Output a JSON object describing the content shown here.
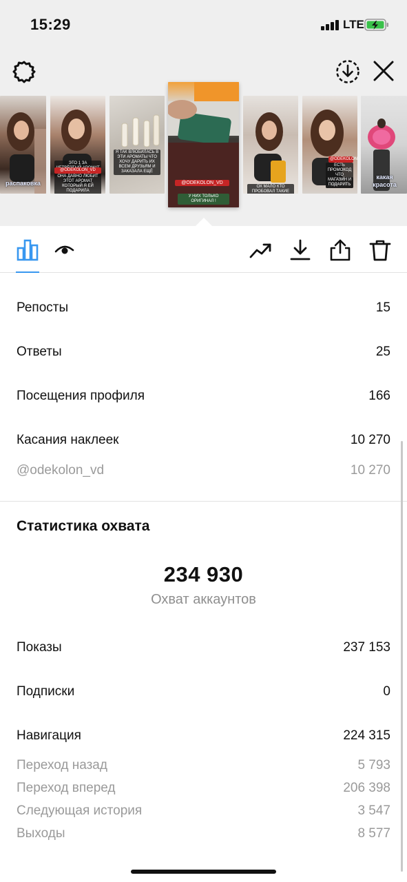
{
  "status_bar": {
    "time": "15:29",
    "network": "LTE"
  },
  "header": {
    "left_icon": "gear-icon",
    "right_icons": [
      "download-circle-icon",
      "close-icon"
    ]
  },
  "stories": [
    {
      "kind": "girl",
      "caption": "распаковка"
    },
    {
      "kind": "girl",
      "caption_lines": [
        "ЭТО 1 ЗА ЧЕТВЁРТЫЙ АРОМАТ КОТОРЫЙ Я ДАРЮ",
        "@ODEKOLON_VD",
        "ОНА ДАВНО ЛЮБИТ ЭТОТ АРОМАТ КОТОРЫЙ Я ЕЙ ПОДАРИЛА"
      ]
    },
    {
      "kind": "perfume",
      "caption_lines": [
        "Я ТАК ВЛЮБИЛАСЬ В ЭТИ АРОМАТЫ ЧТО ХОЧУ ДАРИТЬ ИХ ВСЕМ ДРУЗЬЯМ И ЗАКАЗАЛА ЕЩЁ"
      ]
    },
    {
      "kind": "active",
      "caption_lines": [
        "@ODEKOLON_VD",
        "У НИХ ТОЛЬКО ОРИГИНАЛ !"
      ]
    },
    {
      "kind": "girl",
      "caption_lines": [
        "ОХ МАЛО КТО ПРОБОВАЛ ТАКИЕ АРОМАТЫ"
      ]
    },
    {
      "kind": "girl",
      "caption_lines": [
        "@ODEKOLON_VD",
        "ЕСТЬ ПРОМОКОД ЧТО ВЕРНЁТ ДЕНЬГИ",
        "МАГАЗИН И ПОДАРИТЬ"
      ]
    },
    {
      "kind": "flowers",
      "caption": "какая красота"
    }
  ],
  "toolbar": {
    "left": [
      "bar-chart-icon",
      "eye-icon"
    ],
    "right": [
      "trending-icon",
      "download-icon",
      "share-icon",
      "trash-icon"
    ]
  },
  "interactions": [
    {
      "label": "Репосты",
      "value": "15"
    },
    {
      "label": "Ответы",
      "value": "25"
    },
    {
      "label": "Посещения профиля",
      "value": "166"
    },
    {
      "label": "Касания наклеек",
      "value": "10 270"
    }
  ],
  "sticker_detail": {
    "label": "@odekolon_vd",
    "value": "10 270"
  },
  "reach": {
    "title": "Статистика охвата",
    "accounts_value": "234 930",
    "accounts_label": "Охват аккаунтов",
    "rows": [
      {
        "label": "Показы",
        "value": "237 153"
      },
      {
        "label": "Подписки",
        "value": "0"
      },
      {
        "label": "Навигация",
        "value": "224 315"
      }
    ],
    "navigation_details": [
      {
        "label": "Переход назад",
        "value": "5 793"
      },
      {
        "label": "Переход вперед",
        "value": "206 398"
      },
      {
        "label": "Следующая история",
        "value": "3 547"
      },
      {
        "label": "Выходы",
        "value": "8 577"
      }
    ]
  },
  "colors": {
    "accent": "#3897f0",
    "top_bg": "#efefef",
    "muted": "#9a9a9a"
  }
}
